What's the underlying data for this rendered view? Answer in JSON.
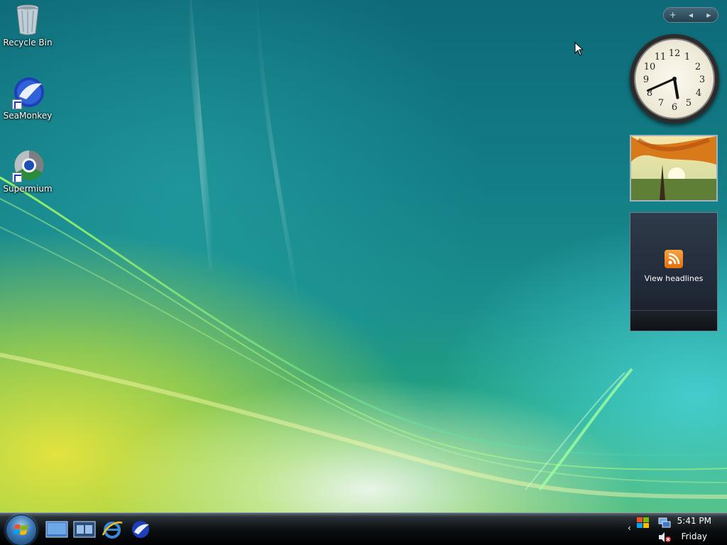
{
  "desktop": {
    "icons": [
      {
        "label": "Recycle Bin",
        "icon": "recycle-bin-icon"
      },
      {
        "label": "SeaMonkey",
        "icon": "seamonkey-icon"
      },
      {
        "label": "Supermium",
        "icon": "supermium-icon"
      }
    ]
  },
  "gadgets": {
    "controls": {
      "add": "+",
      "prev": "◂",
      "next": "▸"
    },
    "clock": {
      "numbers": [
        "12",
        "1",
        "2",
        "3",
        "4",
        "5",
        "6",
        "7",
        "8",
        "9",
        "10",
        "11"
      ],
      "time": "5:41"
    },
    "feed": {
      "label": "View headlines"
    }
  },
  "taskbar": {
    "quick_launch": [
      "show-desktop-icon",
      "switch-windows-icon",
      "internet-explorer-icon",
      "seamonkey-icon"
    ],
    "tray": {
      "chevron": "‹",
      "time": "5:41 PM",
      "day": "Friday"
    }
  },
  "colors": {
    "wallpaper_top": "#0e6a78",
    "wallpaper_bottom": "#5ab866",
    "taskbar": "#0d1114",
    "rss_orange": "#e2700c"
  }
}
